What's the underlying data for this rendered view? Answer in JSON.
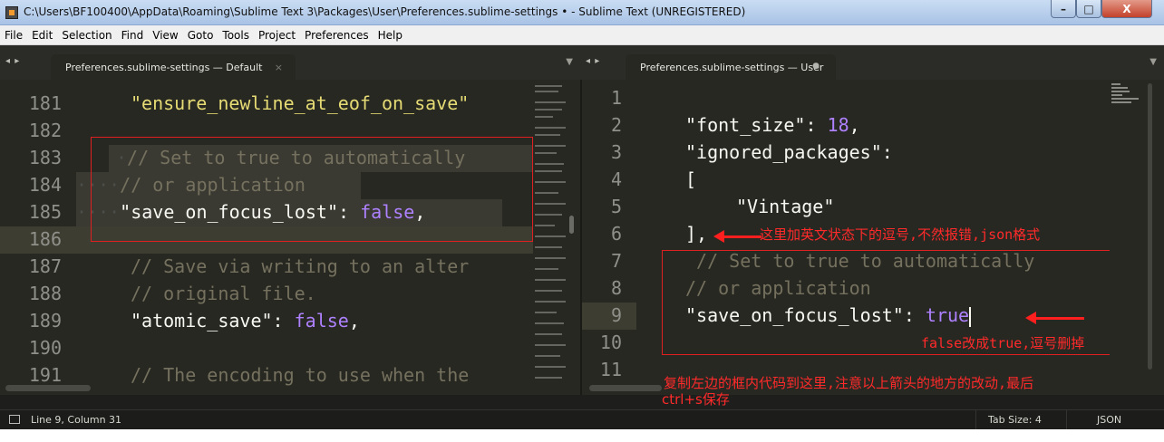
{
  "window": {
    "title": "C:\\Users\\BF100400\\AppData\\Roaming\\Sublime Text 3\\Packages\\User\\Preferences.sublime-settings • - Sublime Text (UNREGISTERED)",
    "minimize": "–",
    "maximize": "□",
    "close": "X"
  },
  "menu": [
    "File",
    "Edit",
    "Selection",
    "Find",
    "View",
    "Goto",
    "Tools",
    "Project",
    "Preferences",
    "Help"
  ],
  "tabs": {
    "left": {
      "label": "Preferences.sublime-settings — Default",
      "close": "×",
      "nav": "◂ ▸",
      "dropdown": "▼"
    },
    "right": {
      "label": "Preferences.sublime-settings — User",
      "dirty": "●",
      "nav": "◂ ▸",
      "dropdown": "▼"
    }
  },
  "left_editor": {
    "lines": [
      {
        "num": "181",
        "text": "\"ensure_newline_at_eof_on_save\""
      },
      {
        "num": "182",
        "text": ""
      },
      {
        "num": "183",
        "text": "// Set to true to automatically"
      },
      {
        "num": "184",
        "text": "// or application"
      },
      {
        "num": "185",
        "key": "\"save_on_focus_lost\"",
        "sep": ": ",
        "value": "false",
        "tail": ","
      },
      {
        "num": "186",
        "text": ""
      },
      {
        "num": "187",
        "text": "// Save via writing to an alter"
      },
      {
        "num": "188",
        "text": "// original file."
      },
      {
        "num": "189",
        "key": "\"atomic_save\"",
        "sep": ": ",
        "value": "false",
        "tail": ","
      },
      {
        "num": "190",
        "text": ""
      },
      {
        "num": "191",
        "text": "// The encoding to use when the"
      }
    ]
  },
  "right_editor": {
    "lines": [
      {
        "num": "1",
        "text": ""
      },
      {
        "num": "2",
        "key": "\"font_size\"",
        "sep": ": ",
        "value": "18",
        "tail": ","
      },
      {
        "num": "3",
        "text": "\"ignored_packages\":"
      },
      {
        "num": "4",
        "text": "["
      },
      {
        "num": "5",
        "text": "\"Vintage\""
      },
      {
        "num": "6",
        "text": "],"
      },
      {
        "num": "7",
        "text": " // Set to true to automatically"
      },
      {
        "num": "8",
        "text": "// or application"
      },
      {
        "num": "9",
        "key": "\"save_on_focus_lost\"",
        "sep": ": ",
        "value": "true"
      },
      {
        "num": "10",
        "text": ""
      },
      {
        "num": "11",
        "text": ""
      }
    ]
  },
  "annotations": {
    "comma_note": "这里加英文状态下的逗号,不然报错,json格式",
    "true_note": "false改成true,逗号删掉",
    "copy_note_1": "复制左边的框内代码到这里,注意以上箭头的地方的改动,最后",
    "copy_note_2": "ctrl+s保存"
  },
  "status": {
    "position": "Line 9, Column 31",
    "tab_size": "Tab Size: 4",
    "syntax": "JSON"
  }
}
